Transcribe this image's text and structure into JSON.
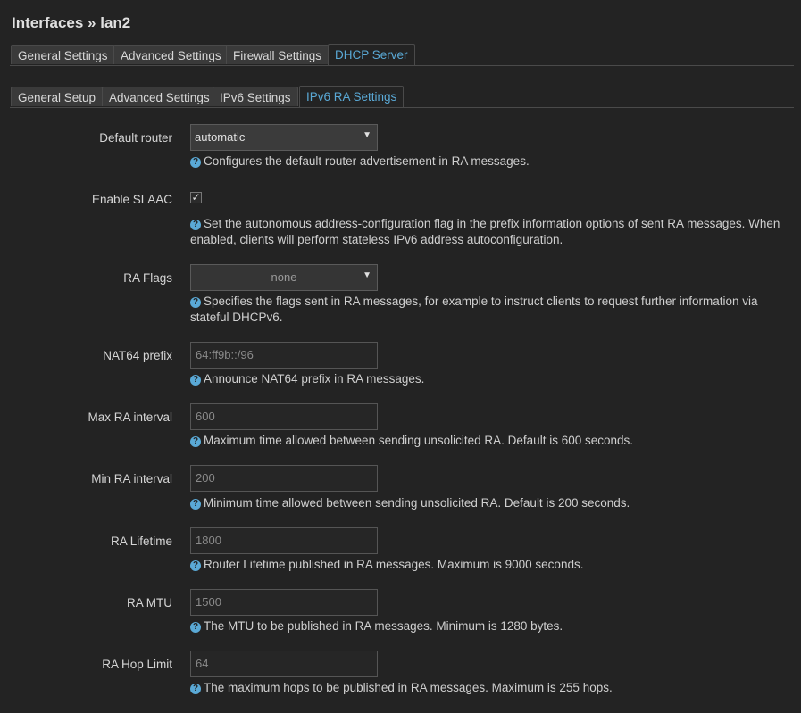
{
  "page": {
    "title": "Interfaces » lan2"
  },
  "tabs_main": [
    {
      "label": "General Settings"
    },
    {
      "label": "Advanced Settings"
    },
    {
      "label": "Firewall Settings"
    },
    {
      "label": "DHCP Server",
      "active": true
    }
  ],
  "tabs_sub": [
    {
      "label": "General Setup"
    },
    {
      "label": "Advanced Settings"
    },
    {
      "label": "IPv6 Settings"
    },
    {
      "label": "IPv6 RA Settings",
      "active": true
    }
  ],
  "fields": {
    "default_router": {
      "label": "Default router",
      "value": "automatic",
      "help": "Configures the default router advertisement in RA messages."
    },
    "slaac": {
      "label": "Enable SLAAC",
      "checked": true,
      "help": "Set the autonomous address-configuration flag in the prefix information options of sent RA messages. When enabled, clients will perform stateless IPv6 address autoconfiguration."
    },
    "ra_flags": {
      "label": "RA Flags",
      "value": "none",
      "help": "Specifies the flags sent in RA messages, for example to instruct clients to request further information via stateful DHCPv6."
    },
    "nat64": {
      "label": "NAT64 prefix",
      "placeholder": "64:ff9b::/96",
      "help": "Announce NAT64 prefix in RA messages."
    },
    "max_ra": {
      "label": "Max RA interval",
      "placeholder": "600",
      "help": "Maximum time allowed between sending unsolicited RA. Default is 600 seconds."
    },
    "min_ra": {
      "label": "Min RA interval",
      "placeholder": "200",
      "help": "Minimum time allowed between sending unsolicited RA. Default is 200 seconds."
    },
    "ra_lifetime": {
      "label": "RA Lifetime",
      "placeholder": "1800",
      "help": "Router Lifetime published in RA messages. Maximum is 9000 seconds."
    },
    "ra_mtu": {
      "label": "RA MTU",
      "placeholder": "1500",
      "help": "The MTU to be published in RA messages. Minimum is 1280 bytes."
    },
    "ra_hoplimit": {
      "label": "RA Hop Limit",
      "placeholder": "64",
      "help": "The maximum hops to be published in RA messages. Maximum is 255 hops."
    }
  },
  "icons": {
    "help": "question-circle-icon",
    "dropdown": "caret-down-icon",
    "check": "checkmark-icon"
  },
  "colors": {
    "accent": "#5aa9d6",
    "background": "#232323"
  }
}
